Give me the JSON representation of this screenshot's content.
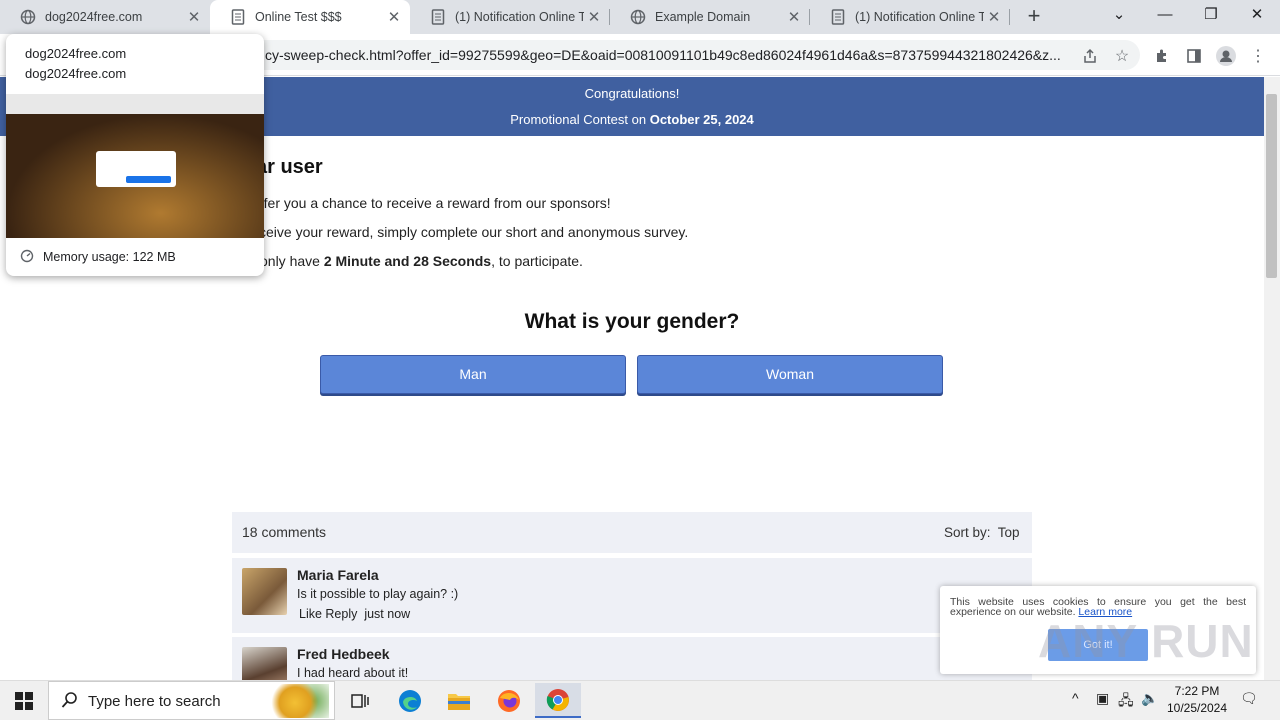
{
  "browser": {
    "tabs": [
      {
        "title": "dog2024free.com",
        "icon": "globe-icon"
      },
      {
        "title": "Online Test $$$",
        "icon": "document-icon"
      },
      {
        "title": "(1) Notification Online Te",
        "icon": "document-icon"
      },
      {
        "title": "Example Domain",
        "icon": "globe-icon"
      },
      {
        "title": "(1) Notification Online Te",
        "icon": "document-icon"
      }
    ],
    "url": "cy-sweep-check.html?offer_id=99275599&geo=DE&oaid=00810091101b49c8ed86024f4961d46a&s=873759944321802426&z..."
  },
  "tab_hover": {
    "title": "dog2024free.com",
    "domain": "dog2024free.com",
    "memory": "Memory usage: 122 MB"
  },
  "banner": {
    "line1": "Congratulations!",
    "line2_prefix": "Promotional Contest on ",
    "line2_date": "October 25, 2024"
  },
  "content": {
    "greeting": "ar user",
    "p1": "ffer you a chance to receive a reward from our sponsors!",
    "p2": "ceive your reward, simply complete our short and anonymous survey.",
    "p3_prefix": "only have ",
    "p3_bold": "2 Minute and 28 Seconds",
    "p3_suffix": ", to participate.",
    "question": "What is your gender?",
    "btn_man": "Man",
    "btn_woman": "Woman"
  },
  "comments": {
    "count_label": "18 comments",
    "sort_label": "Sort by:",
    "sort_value": "Top",
    "items": [
      {
        "name": "Maria Farela",
        "text": "Is it possible to play again? :)",
        "actions": "Like Reply",
        "time": "just now"
      },
      {
        "name": "Fred Hedbeek",
        "text": "I had heard about it!"
      }
    ]
  },
  "cookie": {
    "text": "This website uses cookies to ensure you get the best experience on our website.",
    "link": "Learn more",
    "button": "Got it!"
  },
  "watermark": "ANY RUN",
  "taskbar": {
    "search_placeholder": "Type here to search",
    "time": "7:22 PM",
    "date": "10/25/2024"
  }
}
